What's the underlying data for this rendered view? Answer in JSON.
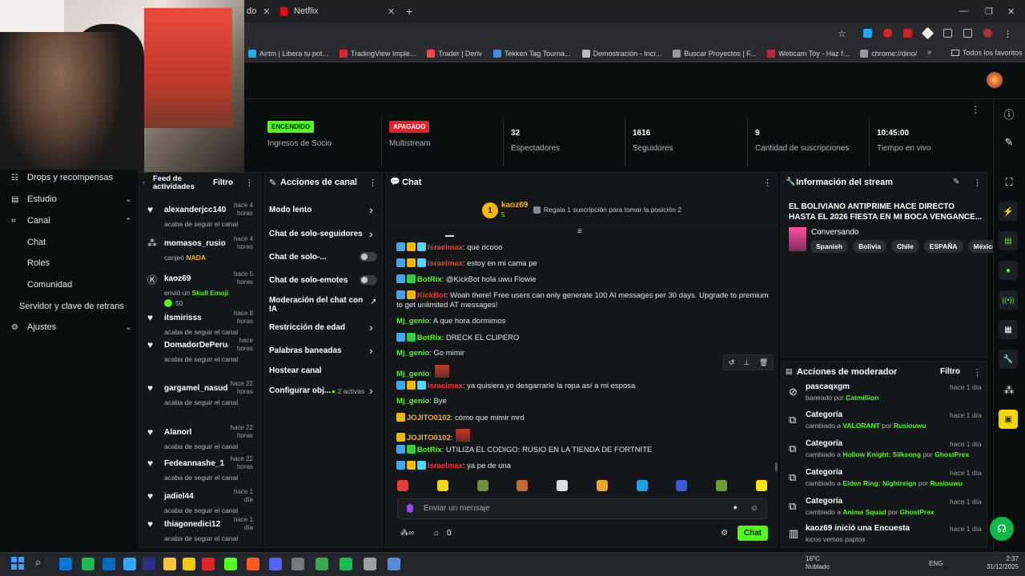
{
  "browser": {
    "tabs": [
      {
        "label": "do"
      },
      {
        "label": "Netflix"
      }
    ],
    "bookmarks": [
      {
        "label": "Airtm | Libera tu pot...",
        "color": "#23a8f2"
      },
      {
        "label": "TradingView Imple...",
        "color": "#e02424"
      },
      {
        "label": "Trader | Deriv",
        "color": "#ff444f"
      },
      {
        "label": "Tekken Tag Tourna...",
        "color": "#3d8ee0"
      },
      {
        "label": "Demostración - Incr...",
        "color": "#bbbbbb"
      },
      {
        "label": "Buscar Proyectos | F...",
        "color": "#999999"
      },
      {
        "label": "Webcam Toy - Haz f...",
        "color": "#cc2233"
      },
      {
        "label": "chrome://dino/",
        "color": "#999999"
      }
    ],
    "all_favorites": "Todos los favoritos"
  },
  "stats": [
    {
      "badge": "ENCENDIDO",
      "badge_color": "#53fc18",
      "label": "Ingresos de Socio"
    },
    {
      "badge": "APAGADO",
      "badge_color": "#e0242a",
      "label": "Multistream"
    },
    {
      "value": "32",
      "label": "Espectadores"
    },
    {
      "value": "1616",
      "label": "Seguidores"
    },
    {
      "value": "9",
      "label": "Cantidad de suscripciones"
    },
    {
      "value": "10:45:00",
      "label": "Tiempo en vivo"
    }
  ],
  "sidebar": {
    "items": [
      {
        "label": "Drops y recompensas",
        "icon": "gift-icon"
      },
      {
        "label": "Estudio",
        "icon": "layout-icon"
      },
      {
        "label": "Canal",
        "icon": "channel-icon"
      },
      {
        "label": "Chat"
      },
      {
        "label": "Roles"
      },
      {
        "label": "Comunidad"
      },
      {
        "label": "Servidor y clave de retrans"
      },
      {
        "label": "Ajustes",
        "icon": "gear-icon"
      }
    ]
  },
  "feed": {
    "title": "Feed de actividades",
    "filter": "Filtro",
    "items": [
      {
        "name": "alexanderjcc140",
        "sub": "acaba de seguir el canal",
        "time": "hace 4 horas",
        "icon": "heart-icon"
      },
      {
        "name": "momasos_rusio",
        "sub": "canjeó",
        "sub_em": "NADA",
        "time": "hace 4 horas",
        "icon": "kick-points-icon"
      },
      {
        "name": "kaoz69",
        "sub": "envió un",
        "sub_em": "Skull Emoji",
        "extra": "50",
        "time": "hace 5 horas",
        "icon": "kick-logo-icon"
      },
      {
        "name": "itsmirisss",
        "sub": "acaba de seguir el canal",
        "time": "hace 8 horas",
        "icon": "heart-icon"
      },
      {
        "name": "DomadorDePeruanas",
        "sub": "acaba de seguir el canal",
        "time": "hace horas",
        "icon": "heart-icon"
      },
      {
        "name": "gargamel_nasudo",
        "sub": "acaba de seguir el canal",
        "time": "hace 22 horas",
        "icon": "heart-icon"
      },
      {
        "name": "Alanorl",
        "sub": "acaba de seguir el canal",
        "time": "hace 22 horas",
        "icon": "heart-icon"
      },
      {
        "name": "Fedeannashe_1",
        "sub": "acaba de seguir el canal",
        "time": "hace 22 horas",
        "icon": "heart-icon"
      },
      {
        "name": "jadiel44",
        "sub": "acaba de seguir el canal",
        "time": "hace 1 día",
        "icon": "heart-icon"
      },
      {
        "name": "thiagonedici12",
        "sub": "acaba de seguir el canal",
        "time": "hace 1 día",
        "icon": "heart-icon"
      }
    ]
  },
  "actions": {
    "title": "Acciones de canal",
    "items": [
      {
        "label": "Modo lento",
        "control": "chevron"
      },
      {
        "label": "Chat de solo-seguidores",
        "control": "chevron"
      },
      {
        "label": "Chat de solo-...",
        "control": "toggle"
      },
      {
        "label": "Chat de solo-emotes",
        "control": "toggle"
      },
      {
        "label": "Moderación del chat con IA",
        "control": "external"
      },
      {
        "label": "Restricción de edad",
        "control": "chevron"
      },
      {
        "label": "Palabras baneadas",
        "control": "chevron"
      },
      {
        "label": "Hostear canal",
        "control": "none"
      },
      {
        "label": "Configurar obj...",
        "control": "chevron",
        "extra": "2 activas"
      }
    ]
  },
  "chat": {
    "title": "Chat",
    "pinned_user": "kaoz69",
    "pinned_count": "5",
    "pinned_rank": "1",
    "gift_text": "Regala 1 suscripción para tomar la posición 2",
    "messages": [
      {
        "user": "Israelmax",
        "user_color": "red",
        "badges": 3,
        "text": ": que ricooo"
      },
      {
        "user": "Israelmax",
        "user_color": "red",
        "badges": 3,
        "text": ": estoy en mi cama pe"
      },
      {
        "user": "BotRix",
        "user_color": "green",
        "badges": 2,
        "text": ": @KickBot hola uwu Flowie"
      },
      {
        "user": "KickBot",
        "user_color": "red",
        "badges": 2,
        "text": ": Woah there! Free users can only generate 100 AI messages per 30 days. Upgrade to premium",
        "text2": "to get unlimited AT messages!"
      },
      {
        "user": "Mj_genio",
        "user_color": "green",
        "badges": 0,
        "text": ": A que hora dormimos"
      },
      {
        "user": "BotRix",
        "user_color": "green",
        "badges": 2,
        "text": ": DRECK EL CLIPERO"
      },
      {
        "user": "Mj_genio",
        "user_color": "green",
        "badges": 0,
        "text": ": Go mimir"
      },
      {
        "user": "Mj_genio",
        "user_color": "green",
        "badges": 0,
        "text": ":",
        "emote": true
      },
      {
        "user": "Israelmax",
        "user_color": "red",
        "badges": 3,
        "text": ": ya quisiera yo desgarrarle la ropa así a mi esposa"
      },
      {
        "user": "Mj_genio",
        "user_color": "green",
        "badges": 0,
        "text": ": Bye"
      },
      {
        "user": "JOJITO0102",
        "user_color": "orange",
        "badges": 1,
        "text": ": cómo que mimir mrd"
      },
      {
        "user": "JOJITO0102",
        "user_color": "orange",
        "badges": 1,
        "text": ":",
        "emote": true
      },
      {
        "user": "BotRix",
        "user_color": "green",
        "badges": 2,
        "text": ": UTILIZA EL CODIGO: RUSIO EN LA TIENDA DE FORTNITE"
      },
      {
        "user": "Israelmax",
        "user_color": "red",
        "badges": 3,
        "text": ": ya pe de una"
      }
    ],
    "input_placeholder": "Enviar un mensaje",
    "points": "0",
    "send_label": "Chat"
  },
  "stream_info": {
    "title": "Información del stream",
    "stream_title": "EL BOLIVIANO ANTIPRIME HACE DIRECTO HASTA EL 2026 FIESTA EN MI BOCA VENGANCE...",
    "category": "Conversando",
    "tags": [
      "Spanish",
      "Bolivia",
      "Chile",
      "ESPAÑA",
      "México"
    ]
  },
  "mod_actions": {
    "title": "Acciones de moderador",
    "filter": "Filtro",
    "items": [
      {
        "title": "pascaqxgm",
        "sub": "baneado por",
        "by": "Catmillion",
        "time": "hace 1 día",
        "icon": "ban-icon"
      },
      {
        "title": "Categoría",
        "sub": "cambiado a",
        "what": "VALORANT",
        "by": "Rusiouwu",
        "time": "hace 1 día",
        "icon": "category-icon"
      },
      {
        "title": "Categoría",
        "sub": "cambiado a",
        "what": "Hollow Knight: Silksong",
        "by": "GhostPrex",
        "time": "hace 1 día",
        "icon": "category-icon"
      },
      {
        "title": "Categoría",
        "sub": "cambiado a",
        "what": "Elden Ring: Nightreign",
        "by": "Rusiouwu",
        "time": "hace 1 día",
        "icon": "category-icon"
      },
      {
        "title": "Categoría",
        "sub": "cambiado a",
        "what": "Anime Squad",
        "by": "GhostPrex",
        "time": "hace 1 día",
        "icon": "category-icon"
      },
      {
        "title": "kaoz69 inició una Encuesta",
        "sub": "kicos vemos paptos",
        "time": "hace 1 día",
        "icon": "poll-icon"
      }
    ]
  },
  "taskbar": {
    "weather_temp": "16°C",
    "weather_desc": "Nublado",
    "lang": "ENG",
    "time": "2:37",
    "date": "31/12/2025"
  },
  "colors": {
    "accent": "#53fc18",
    "panel": "#131719",
    "bg": "#0b0e0f"
  }
}
